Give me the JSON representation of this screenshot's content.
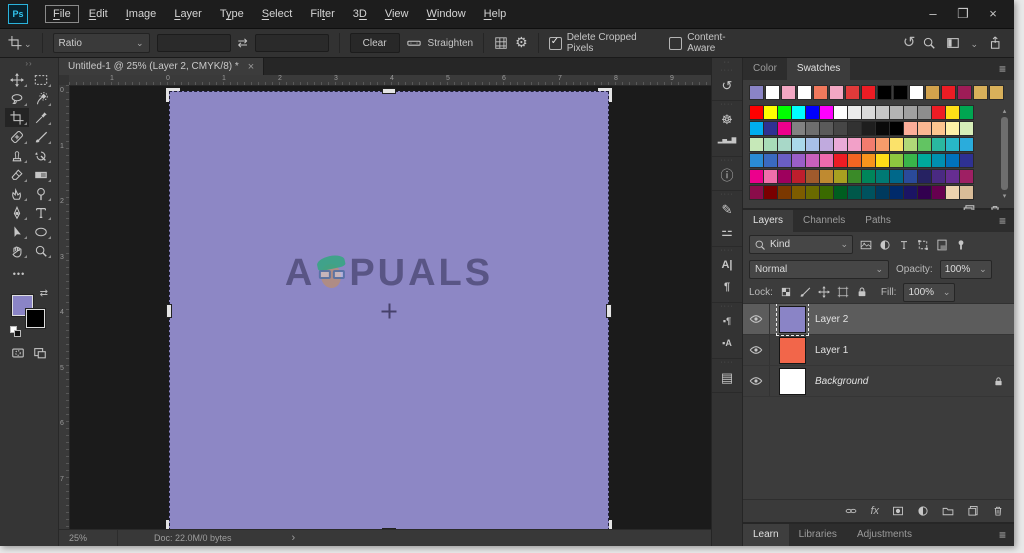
{
  "window": {
    "app_icon_label": "Ps",
    "controls": [
      "minimize",
      "restore",
      "close"
    ]
  },
  "menu": {
    "items": [
      {
        "label": "File",
        "u": 0,
        "focused": true
      },
      {
        "label": "Edit",
        "u": 0
      },
      {
        "label": "Image",
        "u": 0
      },
      {
        "label": "Layer",
        "u": 0
      },
      {
        "label": "Type",
        "u": 1
      },
      {
        "label": "Select",
        "u": 0
      },
      {
        "label": "Filter",
        "u": 3
      },
      {
        "label": "3D",
        "u": 1
      },
      {
        "label": "View",
        "u": 0
      },
      {
        "label": "Window",
        "u": 0
      },
      {
        "label": "Help",
        "u": 0
      }
    ]
  },
  "options_bar": {
    "tool_icon": "crop",
    "ratio_value": "Ratio",
    "width_value": "",
    "height_value": "",
    "clear_label": "Clear",
    "straighten_label": "Straighten",
    "delete_cropped_label": "Delete Cropped Pixels",
    "delete_cropped_checked": true,
    "content_aware_label": "Content-Aware",
    "content_aware_checked": false
  },
  "toolbar": {
    "selected_tool": "crop",
    "tools": [
      "move",
      "marquee",
      "lasso",
      "quick-select",
      "crop",
      "eyedropper",
      "healing",
      "brush",
      "stamp",
      "history-brush",
      "eraser",
      "gradient",
      "smudge",
      "dodge",
      "pen",
      "type",
      "path-select",
      "ellipse",
      "hand",
      "zoom"
    ],
    "foreground_color": "#8a84c6",
    "background_color": "#000000"
  },
  "document": {
    "tab_title": "Untitled-1 @ 25% (Layer 2, CMYK/8) *",
    "canvas_color": "#8d87c5",
    "watermark_prefix": "A",
    "watermark_suffix": "PUALS",
    "ruler_top": [
      "1",
      "0",
      "1",
      "2",
      "3",
      "4",
      "5",
      "6",
      "7",
      "8",
      "9"
    ],
    "ruler_left": [
      "0",
      "1",
      "2",
      "3",
      "4",
      "5",
      "6",
      "7"
    ]
  },
  "status_bar": {
    "zoom_level": "25%",
    "doc_info": "Doc: 22.0M/0 bytes"
  },
  "dock": {
    "groups": [
      [
        "history"
      ],
      [
        "navigator",
        "histogram"
      ],
      [
        "info"
      ],
      [
        "brush-settings",
        "properties"
      ],
      [
        "character",
        "paragraph"
      ],
      [
        "paragraph-styles",
        "character-styles"
      ],
      [
        "notes"
      ]
    ]
  },
  "swatches_panel": {
    "tabs": [
      "Color",
      "Swatches"
    ],
    "active_tab": "Swatches",
    "recent_swatches": [
      "#8a84c6",
      "#ffffff",
      "#f2a7c3",
      "#ffffff",
      "#f0785c",
      "#f2a7c3",
      "#e03a3a",
      "#ed1c24",
      "#000000",
      "#000000",
      "#ffffff",
      "#d2a24c",
      "#ed1c24",
      "#9e1c57",
      "#d8b05a",
      "#d8b05a"
    ],
    "swatch_grid": [
      [
        "#ff0000",
        "#ffff00",
        "#00ff00",
        "#00ffff",
        "#0000ff",
        "#ff00ff",
        "#ffffff",
        "#ebebeb",
        "#d9d9d9",
        "#c6c6c6",
        "#b3b3b3",
        "#a0a0a0",
        "#8d8d8d",
        "#ed1c24",
        "#ffde17",
        "#00a651"
      ],
      [
        "#00aeef",
        "#2e3192",
        "#ec008c",
        "#828282",
        "#6e6e6e",
        "#5a5a5a",
        "#464646",
        "#323232",
        "#1e1e1e",
        "#0a0a0a",
        "#000000",
        "#fbad99",
        "#fbb792",
        "#fdc58f",
        "#fff2a8",
        "#d7eeb8"
      ],
      [
        "#c6e8b8",
        "#a8dcb8",
        "#a8d8c8",
        "#aad8ea",
        "#a8c0e8",
        "#c0aade",
        "#eaaad8",
        "#f2a0c8",
        "#f27c6e",
        "#f79c6a",
        "#fbe26a",
        "#b0d878",
        "#62c462",
        "#2ab8a0",
        "#28b8c8",
        "#2aacdc"
      ],
      [
        "#2a8cd4",
        "#3a6ac0",
        "#6a5ec4",
        "#9a5ec8",
        "#c860bc",
        "#ee6aae",
        "#ed1c24",
        "#f26522",
        "#f7941d",
        "#ffde17",
        "#8dc63f",
        "#39b54a",
        "#00a99d",
        "#0090b0",
        "#0072bc",
        "#2e3192"
      ],
      [
        "#ec008c",
        "#f06eaa",
        "#9e005d",
        "#be1e2d",
        "#a05a2c",
        "#bf8a30",
        "#a8a020",
        "#3a8a28",
        "#00855a",
        "#007a74",
        "#00688a",
        "#2a4a9a",
        "#262262",
        "#4a2a82",
        "#662d91",
        "#9e1f63"
      ],
      [
        "#8a0c4a",
        "#790000",
        "#7b3800",
        "#7d5c00",
        "#6a6a00",
        "#3a6a00",
        "#005e20",
        "#00584a",
        "#00525e",
        "#003a5e",
        "#002a6a",
        "#1b1464",
        "#32004f",
        "#66004f",
        "#ecd2ae",
        "#d9bc98"
      ]
    ]
  },
  "layers_panel": {
    "tabs": [
      "Layers",
      "Channels",
      "Paths"
    ],
    "active_tab": "Layers",
    "filter_value": "Kind",
    "blend_mode": "Normal",
    "opacity_label": "Opacity:",
    "opacity_value": "100%",
    "lock_label": "Lock:",
    "fill_label": "Fill:",
    "fill_value": "100%",
    "layers": [
      {
        "name": "Layer 2",
        "thumb_color": "#8a84c6",
        "selected": true
      },
      {
        "name": "Layer 1",
        "thumb_color": "#f2664a",
        "selected": false
      },
      {
        "name": "Background",
        "thumb_color": "#ffffff",
        "selected": false,
        "italic": true,
        "locked": true
      }
    ]
  },
  "bottom_panel": {
    "tabs": [
      "Learn",
      "Libraries",
      "Adjustments"
    ],
    "active_tab": "Learn"
  }
}
